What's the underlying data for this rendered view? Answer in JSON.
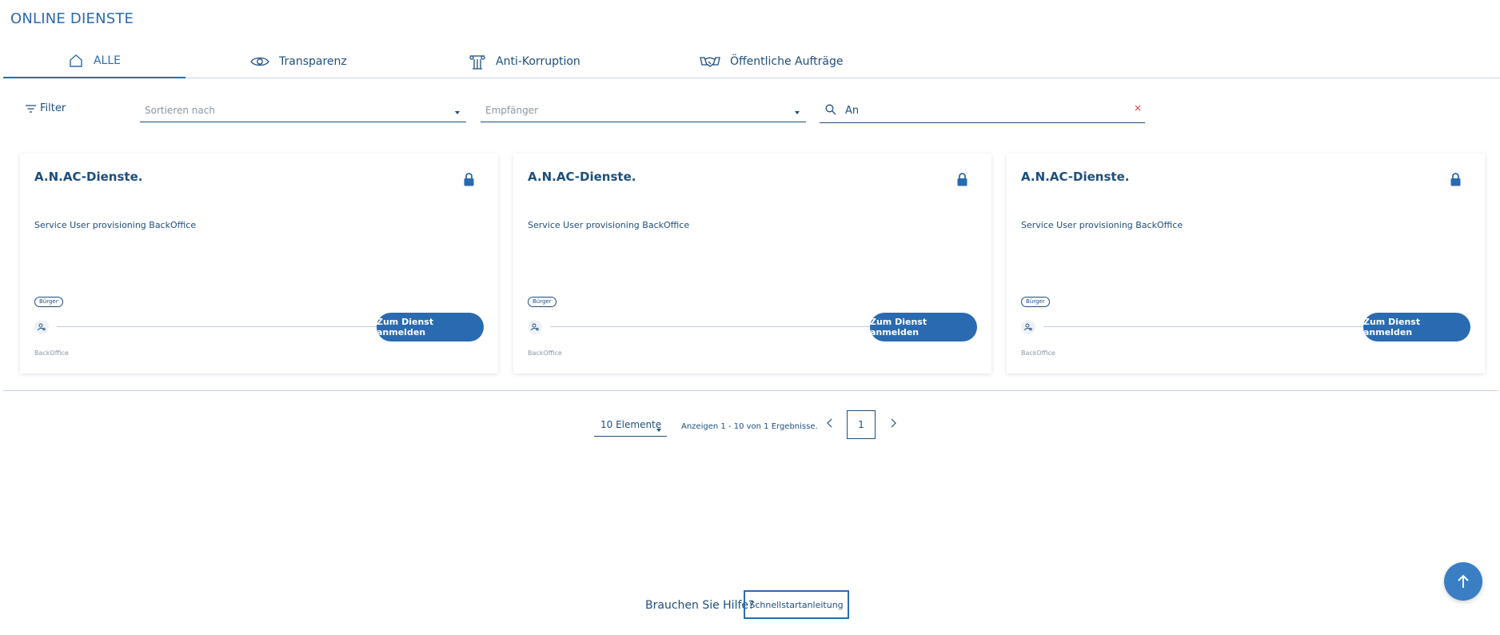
{
  "page": {
    "title": "ONLINE DIENSTE"
  },
  "tabs": [
    {
      "label": "ALLE",
      "icon": "home-icon",
      "active": true
    },
    {
      "label": "Transparenz",
      "icon": "eye-icon",
      "active": false
    },
    {
      "label": "Anti-Korruption",
      "icon": "column-icon",
      "active": false
    },
    {
      "label": "Öffentliche Aufträge",
      "icon": "handshake-icon",
      "active": false
    }
  ],
  "filters": {
    "filter_label": "Filter",
    "sort_placeholder": "Sortieren nach",
    "recipient_placeholder": "Empfänger",
    "search_value": "An",
    "clear_symbol": "×"
  },
  "cards": [
    {
      "title": "A.N.AC-Dienste.",
      "description": "Service User provisioning BackOffice",
      "badge": "Bürger",
      "button": "Zum Dienst anmelden",
      "owner": "BackOffice"
    },
    {
      "title": "A.N.AC-Dienste.",
      "description": "Service User provisioning BackOffice",
      "badge": "Bürger",
      "button": "Zum Dienst anmelden",
      "owner": "BackOffice"
    },
    {
      "title": "A.N.AC-Dienste.",
      "description": "Service User provisioning BackOffice",
      "badge": "Bürger",
      "button": "Zum Dienst anmelden",
      "owner": "BackOffice"
    }
  ],
  "pagination": {
    "page_size": "10 Elemente",
    "info": "Anzeigen 1 - 10 von 1 Ergebnisse.",
    "current_page": "1"
  },
  "help": {
    "label": "Brauchen Sie Hilfe?",
    "button": "Schnellstartanleitung"
  },
  "colors": {
    "primary": "#2a6ab0",
    "text": "#1d4e7e",
    "muted": "#8a96a3",
    "clear": "#d23c3c"
  }
}
